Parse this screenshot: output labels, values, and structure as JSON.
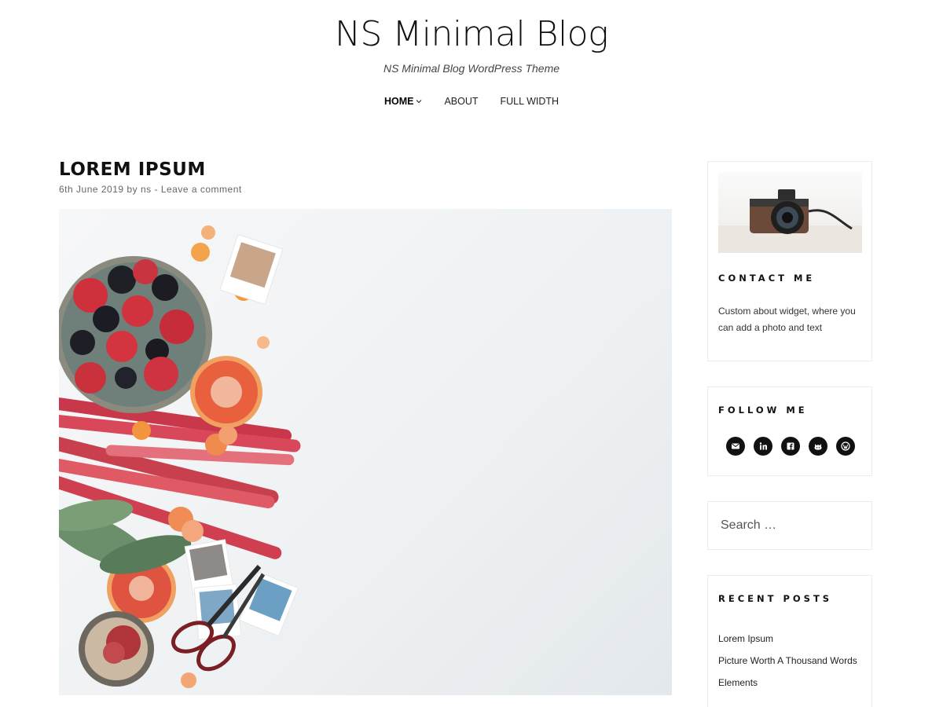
{
  "header": {
    "title": "NS Minimal Blog",
    "tagline": "NS Minimal Blog WordPress Theme"
  },
  "nav": {
    "items": [
      {
        "label": "HOME",
        "active": true
      },
      {
        "label": "ABOUT",
        "active": false
      },
      {
        "label": "FULL WIDTH",
        "active": false
      }
    ]
  },
  "post": {
    "title": "LOREM IPSUM",
    "date": "6th June 2019",
    "by": "by",
    "author": "ns",
    "separator": "-",
    "comment_link": "Leave a comment"
  },
  "sidebar": {
    "about": {
      "title": "CONTACT ME",
      "text": "Custom about widget, where you can add a photo and text"
    },
    "follow": {
      "title": "FOLLOW ME",
      "icons": [
        "email-icon",
        "linkedin-icon",
        "facebook-icon",
        "github-icon",
        "wordpress-icon"
      ]
    },
    "search": {
      "placeholder": "Search …"
    },
    "recent": {
      "title": "RECENT POSTS",
      "items": [
        "Lorem Ipsum",
        "Picture Worth A Thousand Words",
        "Elements"
      ]
    }
  },
  "colors": {
    "text": "#111111",
    "muted": "#666666",
    "border": "#ececec",
    "social_bg": "#111111"
  }
}
